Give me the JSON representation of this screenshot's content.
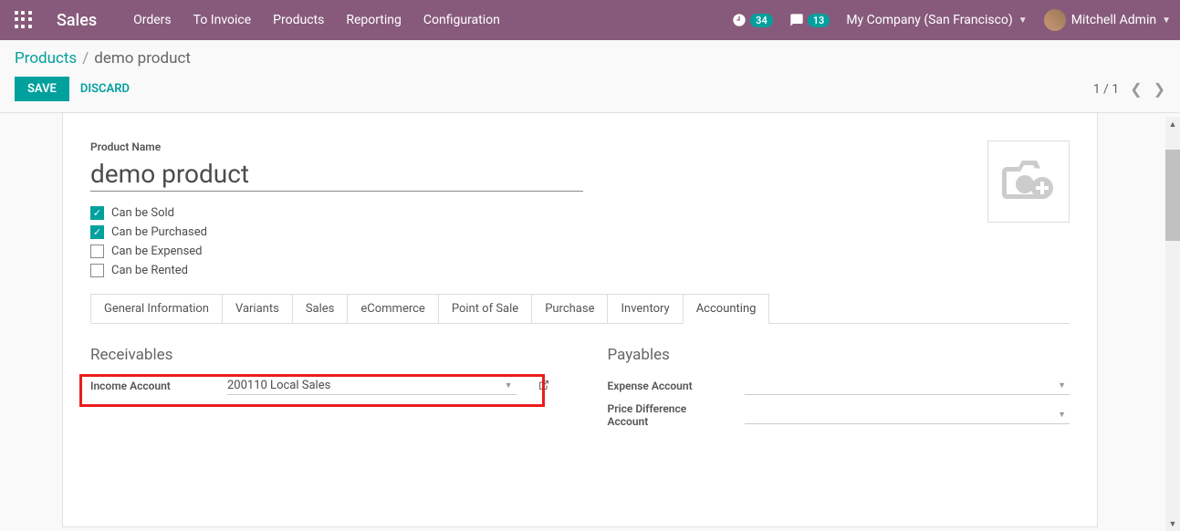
{
  "nav": {
    "app_title": "Sales",
    "menu": [
      "Orders",
      "To Invoice",
      "Products",
      "Reporting",
      "Configuration"
    ],
    "activity_count": "34",
    "message_count": "13",
    "company": "My Company (San Francisco)",
    "user": "Mitchell Admin"
  },
  "breadcrumb": {
    "parent": "Products",
    "current": "demo product"
  },
  "actions": {
    "save": "SAVE",
    "discard": "DISCARD",
    "pager": "1 / 1"
  },
  "form": {
    "product_name_label": "Product Name",
    "product_name": "demo product",
    "checkboxes": {
      "sold": {
        "label": "Can be Sold",
        "checked": true
      },
      "purchased": {
        "label": "Can be Purchased",
        "checked": true
      },
      "expensed": {
        "label": "Can be Expensed",
        "checked": false
      },
      "rented": {
        "label": "Can be Rented",
        "checked": false
      }
    }
  },
  "tabs": [
    "General Information",
    "Variants",
    "Sales",
    "eCommerce",
    "Point of Sale",
    "Purchase",
    "Inventory",
    "Accounting"
  ],
  "active_tab": "Accounting",
  "accounting": {
    "receivables_title": "Receivables",
    "income_account_label": "Income Account",
    "income_account_value": "200110 Local Sales",
    "payables_title": "Payables",
    "expense_account_label": "Expense Account",
    "expense_account_value": "",
    "price_diff_label": "Price Difference Account",
    "price_diff_value": ""
  }
}
